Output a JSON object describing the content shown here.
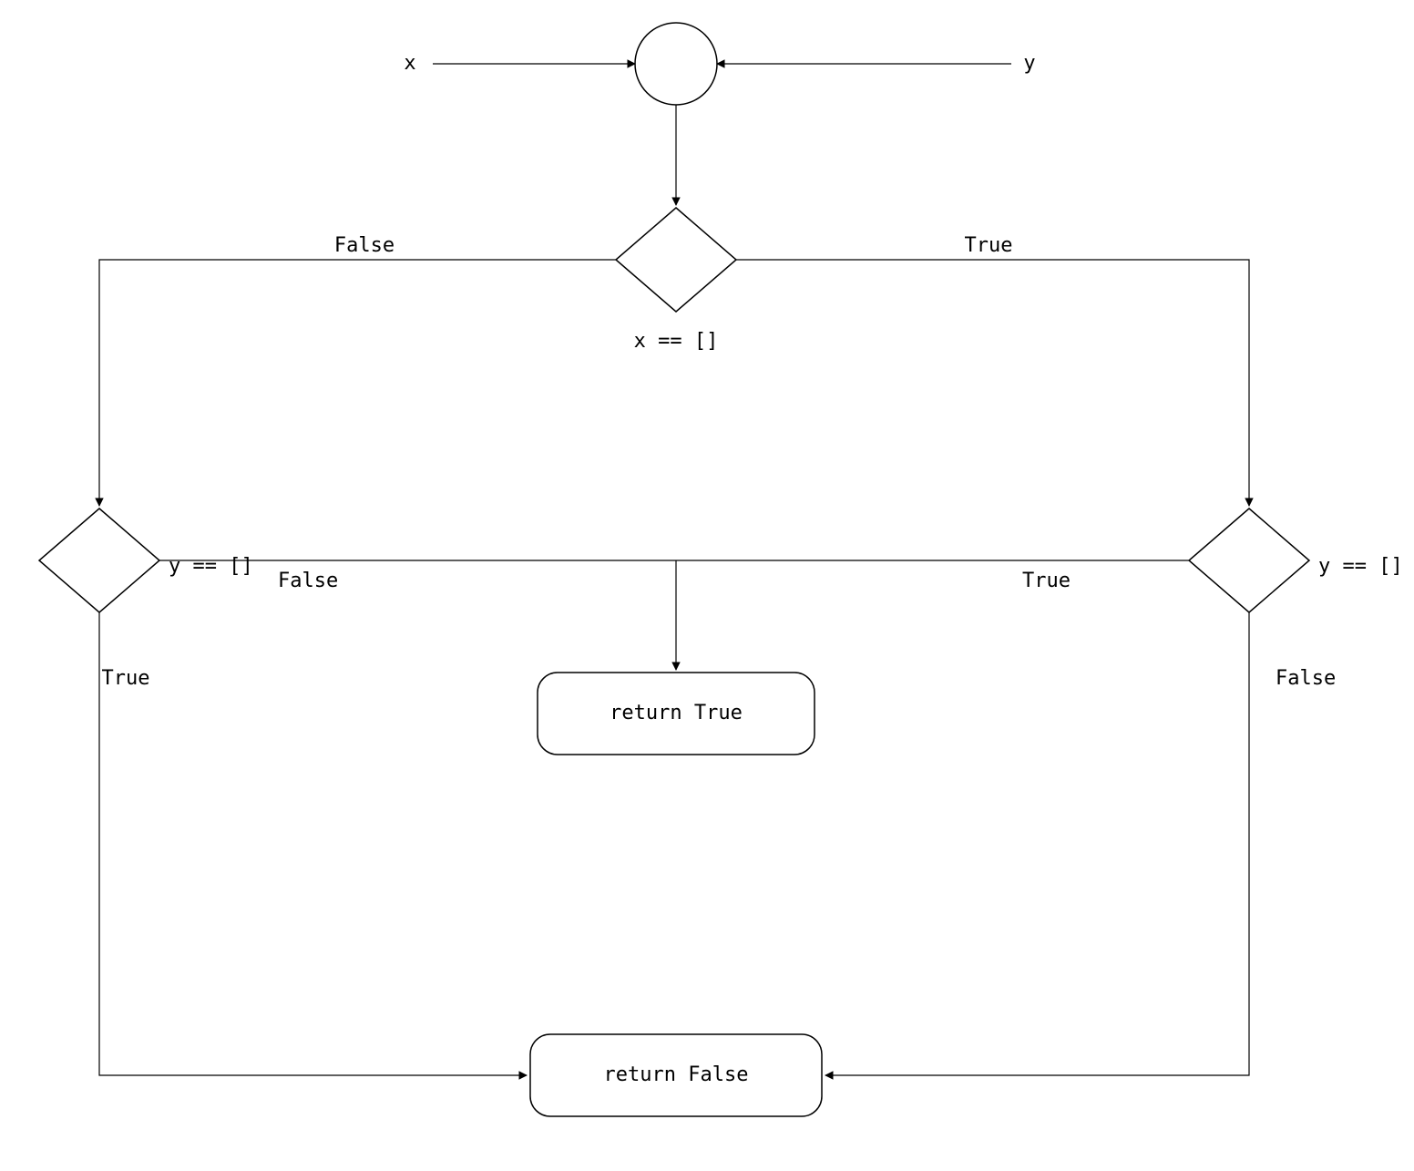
{
  "inputs": {
    "left": "x",
    "right": "y"
  },
  "decisions": {
    "top": "x == []",
    "left": "y == []",
    "right": "y == []"
  },
  "edge_labels": {
    "top_left": "False",
    "top_right": "True",
    "left_down": "True",
    "left_right": "False",
    "right_down": "False",
    "right_left": "True"
  },
  "terminals": {
    "true_box": "return True",
    "false_box": "return False"
  }
}
